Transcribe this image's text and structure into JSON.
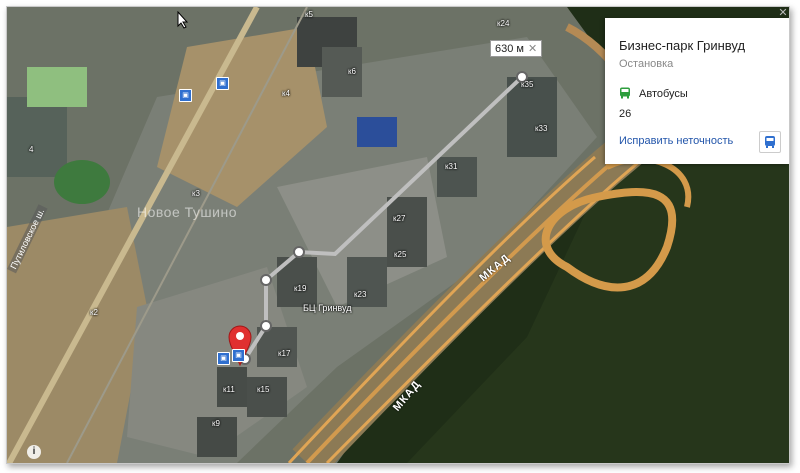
{
  "card": {
    "title": "Бизнес-парк Гринвуд",
    "subtitle": "Остановка",
    "transport_type": "Автобусы",
    "routes": "26",
    "fix_link": "Исправить неточность",
    "icons": [
      "bus-icon",
      "bus-button-icon"
    ]
  },
  "ruler": {
    "distance": "630 м",
    "close": "✕"
  },
  "map_labels": {
    "district": "Новое Тушино",
    "street": "Путиловское ш.",
    "mkad1": "МКАД",
    "mkad2": "МКАД",
    "poi": "БЦ Гринвуд",
    "buildings": [
      "к5",
      "к6",
      "к24",
      "к4",
      "к35",
      "к33",
      "к3",
      "к31",
      "к27",
      "к25",
      "к19",
      "к23",
      "к2",
      "к17",
      "к11",
      "к15",
      "к9",
      "4"
    ]
  },
  "colors": {
    "route_line": "#bfbfbf",
    "pin": "#e03030",
    "stop": "#2f6fcf",
    "link": "#2255aa"
  },
  "info_button": "i"
}
